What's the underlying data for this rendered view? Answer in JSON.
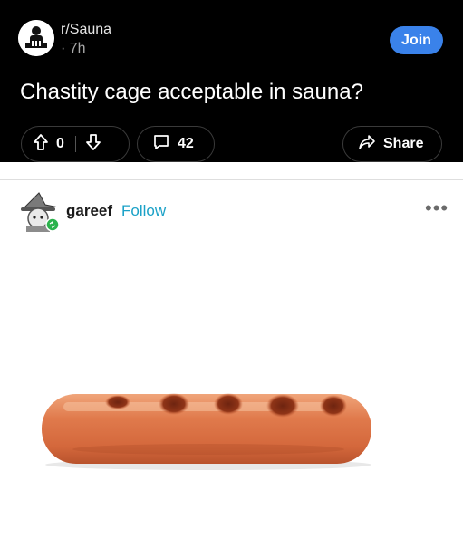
{
  "post": {
    "subreddit": "r/Sauna",
    "time": "· 7h",
    "join_label": "Join",
    "title": "Chastity cage acceptable in sauna?",
    "vote_count": "0",
    "comment_count": "42",
    "share_label": "Share"
  },
  "reply": {
    "username": "gareef",
    "follow_label": "Follow",
    "more_label": "•••"
  },
  "media": {
    "subject": "sausage-image"
  },
  "colors": {
    "header_bg": "#000000",
    "join_button": "#3a82ea",
    "follow_link": "#1aa1c7",
    "page_bg": "#ffffff"
  },
  "icons": [
    "subreddit-avatar-icon",
    "upvote-icon",
    "downvote-icon",
    "comment-icon",
    "share-icon",
    "user-avatar-icon",
    "more-options-icon"
  ]
}
